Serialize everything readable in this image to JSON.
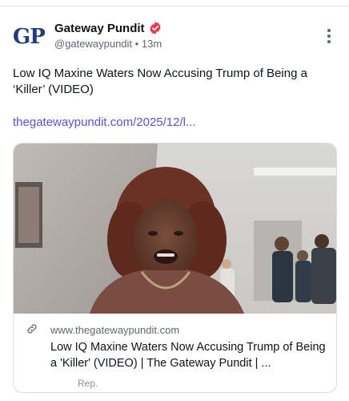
{
  "post": {
    "avatar_text": "GP",
    "author_name": "Gateway Pundit",
    "handle": "@gatewaypundit",
    "separator": "•",
    "time_ago": "13m",
    "text": "Low IQ Maxine Waters Now Accusing Trump of Being a ‘Killer’ (VIDEO)",
    "link_text": "thegatewaypundit.com/2025/12/l..."
  },
  "card": {
    "domain": "www.thegatewaypundit.com",
    "title": "Low IQ Maxine Waters Now Accusing Trump of Being a 'Killer' (VIDEO) | The Gateway Pundit | ...",
    "footer_note": "Rep."
  },
  "icons": {
    "verified": "verified-badge-icon",
    "more": "more-vertical-icon",
    "link": "link-icon"
  },
  "colors": {
    "link": "#5b54c6",
    "verified_badge": "#e8384f",
    "avatar_text": "#1f3d7a",
    "muted": "#606770"
  }
}
